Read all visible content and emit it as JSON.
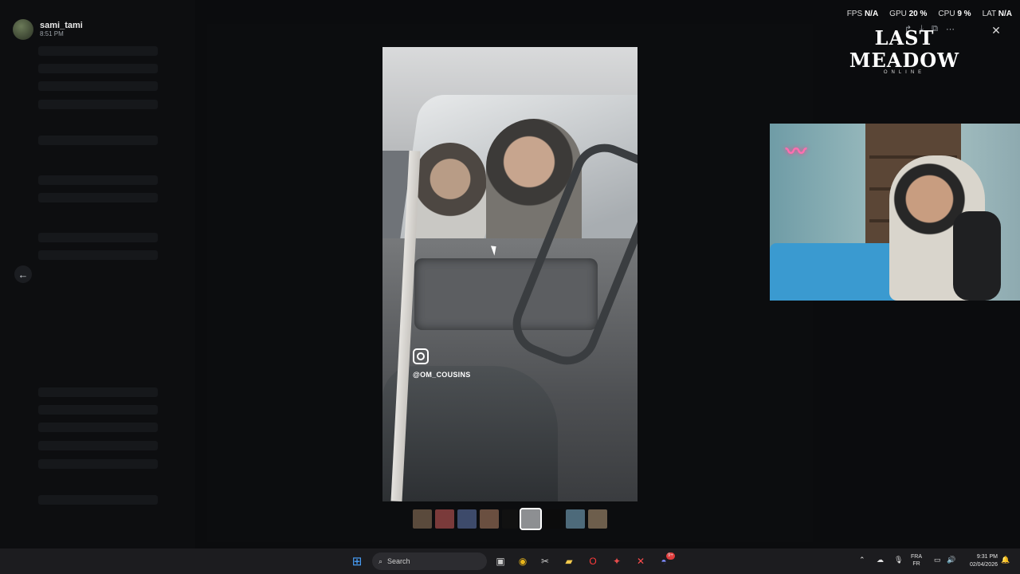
{
  "user": {
    "name": "sami_tami",
    "time": "8:51 PM"
  },
  "stats": {
    "fps_label": "FPS",
    "fps_value": "N/A",
    "gpu_label": "GPU",
    "gpu_value": "20 %",
    "cpu_label": "CPU",
    "cpu_value": "9 %",
    "lat_label": "LAT",
    "lat_value": "N/A"
  },
  "logo": {
    "title": "LAST MEADOW",
    "subtitle": "ONLINE"
  },
  "media": {
    "handle": "@OM_COUSINS"
  },
  "taskbar": {
    "search_label": "Search",
    "lang_top": "FRA",
    "lang_bottom": "FR",
    "time": "9:31 PM",
    "date": "02/04/2026",
    "discord_badge": "9+"
  },
  "icons": {
    "back": "arrow-left-icon",
    "close": "close-icon",
    "share": "share-icon",
    "download": "download-icon",
    "open": "open-external-icon",
    "more": "more-icon",
    "windows": "windows-icon",
    "search": "search-icon",
    "instagram": "instagram-icon"
  },
  "colors": {
    "accent": "#5865f2",
    "taskbar": "#1c1c1f",
    "background": "#050506"
  }
}
